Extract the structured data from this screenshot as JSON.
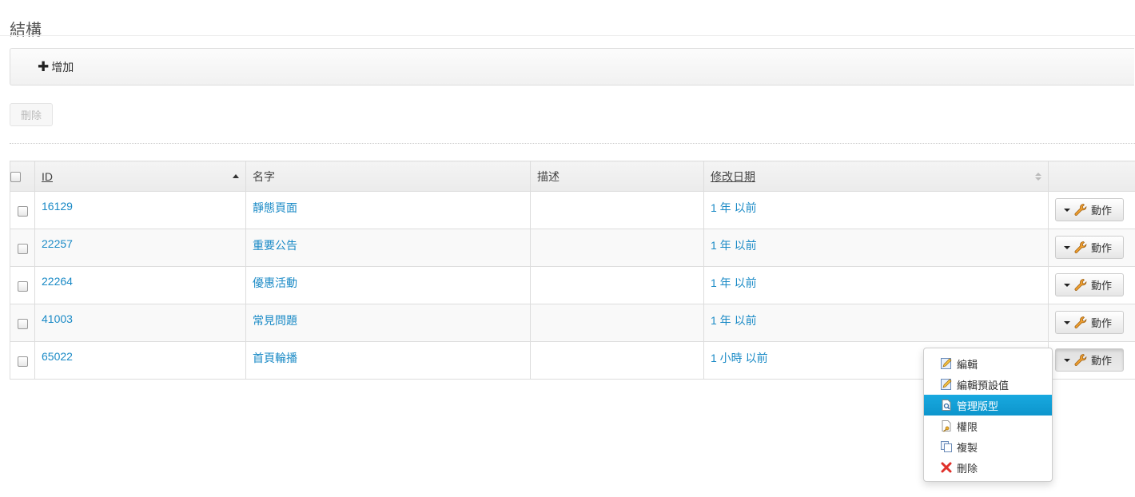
{
  "page": {
    "title": "結構"
  },
  "toolbar": {
    "add_label": "增加"
  },
  "actions": {
    "delete_label": "刪除"
  },
  "table": {
    "columns": [
      "ID",
      "名字",
      "描述",
      "修改日期"
    ],
    "rows": [
      {
        "id": "16129",
        "name": "靜態頁面",
        "description": "",
        "modified": "1 年 以前",
        "action_label": "動作"
      },
      {
        "id": "22257",
        "name": "重要公告",
        "description": "",
        "modified": "1 年 以前",
        "action_label": "動作"
      },
      {
        "id": "22264",
        "name": "優惠活動",
        "description": "",
        "modified": "1 年 以前",
        "action_label": "動作"
      },
      {
        "id": "41003",
        "name": "常見問題",
        "description": "",
        "modified": "1 年 以前",
        "action_label": "動作"
      },
      {
        "id": "65022",
        "name": "首頁輪播",
        "description": "",
        "modified": "1 小時 以前",
        "action_label": "動作"
      }
    ]
  },
  "dropdown": {
    "items": [
      {
        "label": "編輯",
        "icon": "edit-icon"
      },
      {
        "label": "編輯預設值",
        "icon": "edit-icon"
      },
      {
        "label": "管理版型",
        "icon": "page-search-icon",
        "highlighted": true
      },
      {
        "label": "權限",
        "icon": "key-page-icon"
      },
      {
        "label": "複製",
        "icon": "copy-icon"
      },
      {
        "label": "刪除",
        "icon": "delete-x-icon"
      }
    ]
  },
  "colors": {
    "link": "#1a8ac6",
    "highlight": "#0d95cc"
  }
}
